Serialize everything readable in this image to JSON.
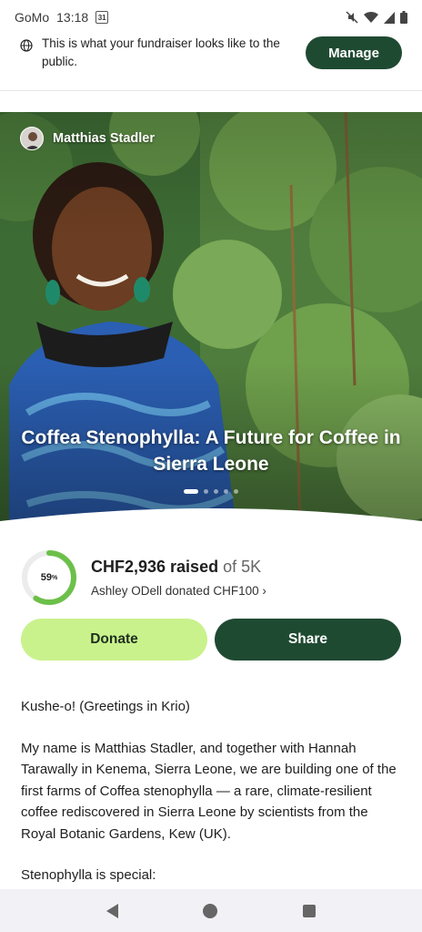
{
  "status_bar": {
    "carrier": "GoMo",
    "time": "13:18",
    "calendar_day": "31"
  },
  "notice": {
    "text": "This is what your fundraiser looks like to the public.",
    "manage_label": "Manage"
  },
  "hero": {
    "organizer_name": "Matthias Stadler",
    "title": "Coffea Stenophylla: A Future for Coffee in Sierra Leone",
    "slide_count": 5,
    "active_slide": 1
  },
  "progress": {
    "percent_label": "59",
    "percent_sign": "%",
    "percent_value": 0.59,
    "raised": "CHF2,936 raised",
    "goal": "of 5K",
    "recent_donation": "Ashley ODell donated CHF100",
    "chevron": "›"
  },
  "actions": {
    "donate_label": "Donate",
    "share_label": "Share"
  },
  "story": {
    "paragraphs": [
      "Kushe-o! (Greetings in Krio)",
      "My name is Matthias Stadler, and together with Hannah Tarawally in Kenema, Sierra Leone, we are building one of the first farms of Coffea stenophylla — a rare, climate-resilient coffee rediscovered in Sierra Leone by scientists from the Royal Botanic Gardens, Kew (UK).",
      "Stenophylla is special:"
    ]
  },
  "colors": {
    "brand_dark": "#1f4a32",
    "brand_light": "#c9f28c",
    "progress_ring": "#6cc04a"
  }
}
